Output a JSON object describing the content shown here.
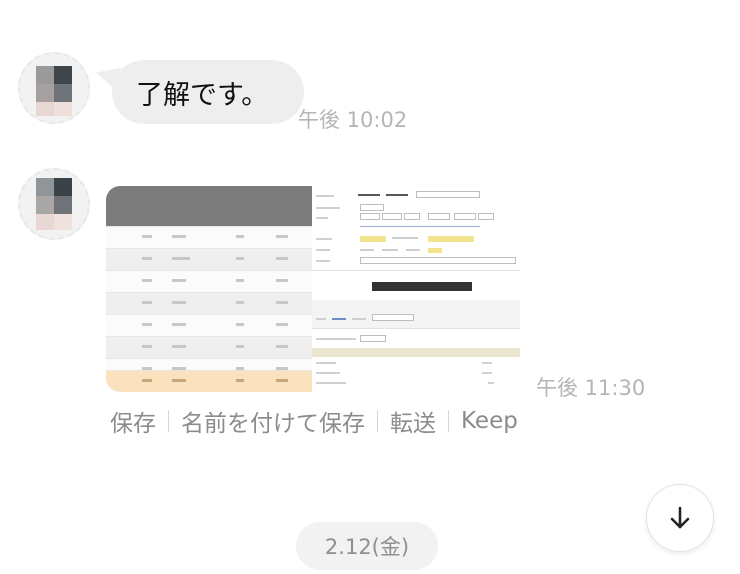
{
  "messages": [
    {
      "type": "text",
      "text": "了解です。",
      "time": "午後 10:02"
    },
    {
      "type": "image",
      "time": "午後 11:30"
    }
  ],
  "image_actions": {
    "save": "保存",
    "save_as": "名前を付けて保存",
    "forward": "転送",
    "keep": "Keep"
  },
  "date_separator": "2.12(金)",
  "icons": {
    "scroll_down": "arrow-down-icon",
    "avatar": "user-avatar-icon"
  },
  "colors": {
    "bubble_bg": "#eeeeef",
    "timestamp": "#b5b5b5",
    "action_text": "#8c8c8c",
    "date_pill_bg": "#f2f2f2"
  }
}
